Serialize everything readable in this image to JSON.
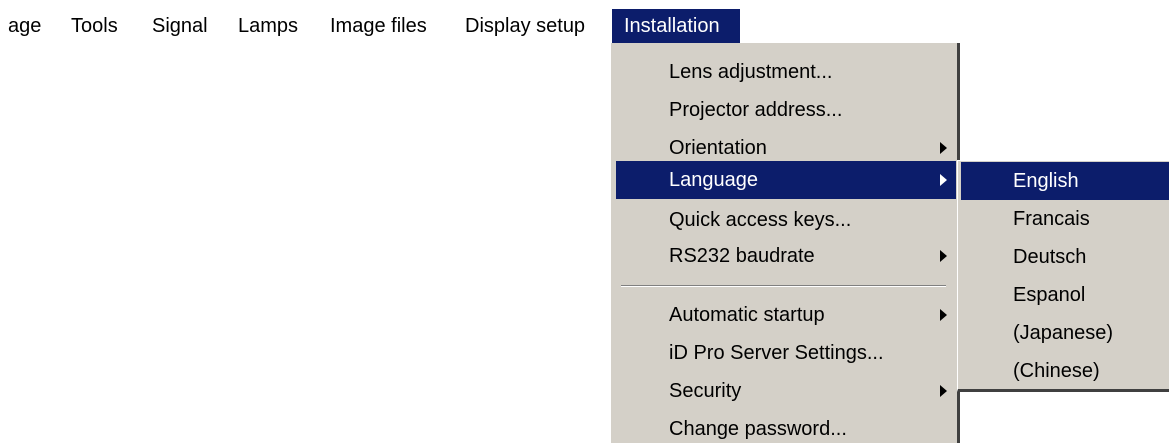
{
  "colors": {
    "menu_background": "#d4d0c8",
    "highlight": "#0c1d6b",
    "highlight_text": "#ffffff",
    "page_background": "#ffffff"
  },
  "menubar": {
    "items": [
      {
        "label": "age"
      },
      {
        "label": "Tools"
      },
      {
        "label": "Signal"
      },
      {
        "label": "Lamps"
      },
      {
        "label": "Image files"
      },
      {
        "label": "Display setup"
      },
      {
        "label": "Installation",
        "active": true
      }
    ]
  },
  "installation_menu": {
    "items": [
      {
        "label": "Lens adjustment..."
      },
      {
        "label": "Projector address..."
      },
      {
        "label": "Orientation",
        "submenu_icon": "chevron-right-icon"
      },
      {
        "label": "Language",
        "submenu_icon": "chevron-right-icon",
        "highlighted": true
      },
      {
        "label": "Quick access keys..."
      },
      {
        "label": "RS232 baudrate",
        "submenu_icon": "chevron-right-icon"
      },
      {
        "label": "Automatic startup",
        "submenu_icon": "chevron-right-icon"
      },
      {
        "label": "iD Pro Server Settings..."
      },
      {
        "label": "Security",
        "submenu_icon": "chevron-right-icon"
      },
      {
        "label": "Change password..."
      }
    ]
  },
  "language_submenu": {
    "items": [
      {
        "label": "English",
        "highlighted": true
      },
      {
        "label": "Francais"
      },
      {
        "label": "Deutsch"
      },
      {
        "label": "Espanol"
      },
      {
        "label": "(Japanese)"
      },
      {
        "label": "(Chinese)"
      }
    ]
  }
}
